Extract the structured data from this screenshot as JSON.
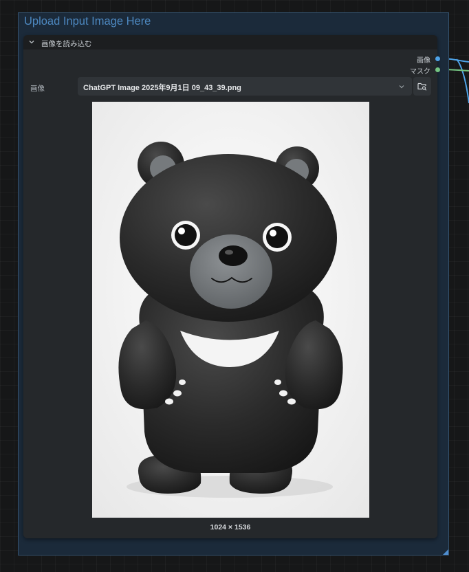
{
  "group": {
    "title": "Upload Input Image Here"
  },
  "node": {
    "title": "画像を読み込む",
    "outputs": [
      {
        "label": "画像",
        "color": "#4ea3e8"
      },
      {
        "label": "マスク",
        "color": "#74c482"
      }
    ],
    "image_field": {
      "label": "画像",
      "value": "ChatGPT Image 2025年9月1日 09_43_39.png"
    },
    "preview": {
      "description": "black bear figurine",
      "dimensions": "1024 × 1536"
    }
  },
  "colors": {
    "group_border": "#34516d",
    "group_title": "#4d88c0",
    "image_port": "#4ea3e8",
    "mask_port": "#74c482"
  }
}
